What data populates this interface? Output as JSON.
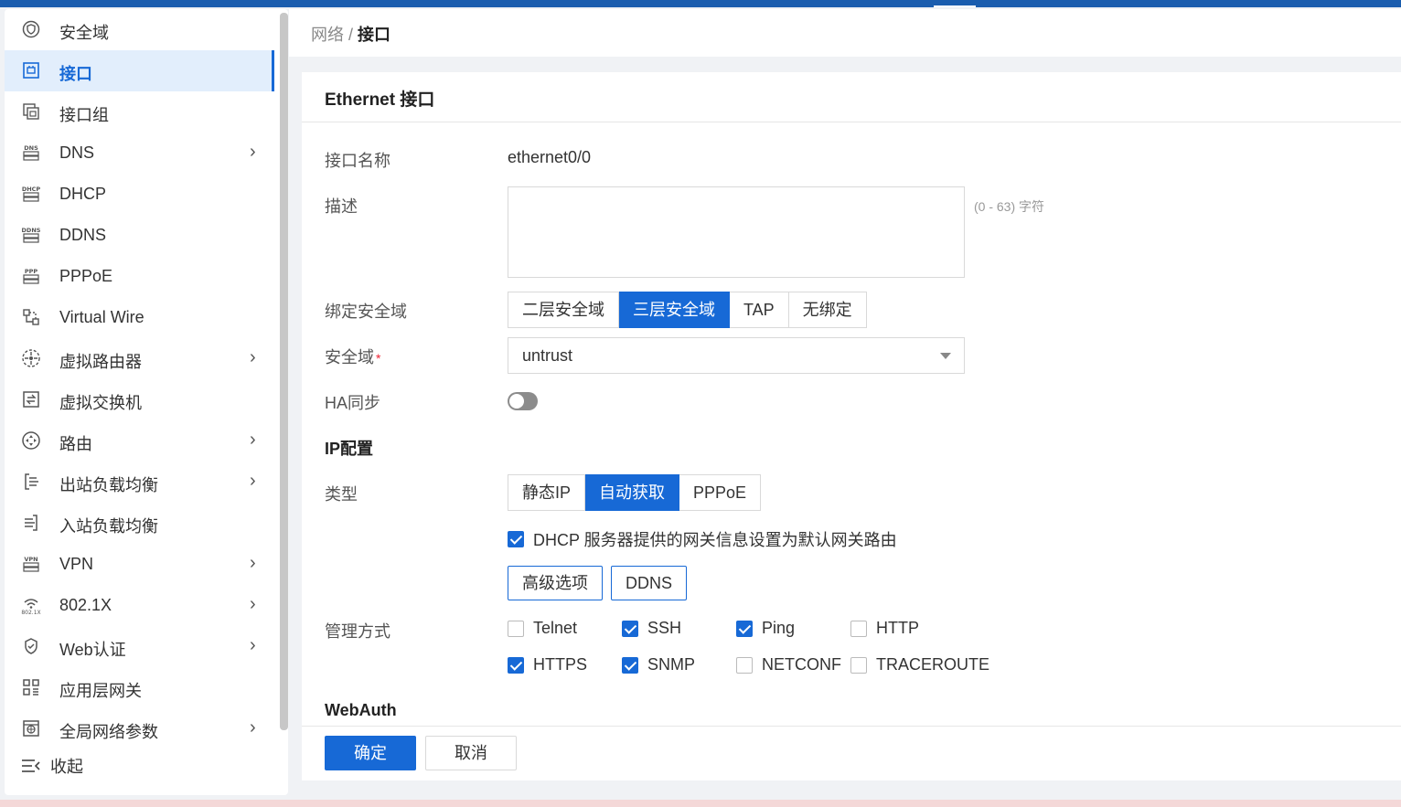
{
  "breadcrumb": {
    "parent": "网络",
    "separator": "/",
    "current": "接口"
  },
  "sidebar": {
    "items": [
      {
        "label": "安全域",
        "icon": "shield-icon",
        "chevron": false,
        "active": false
      },
      {
        "label": "接口",
        "icon": "interface-icon",
        "chevron": false,
        "active": true
      },
      {
        "label": "接口组",
        "icon": "interface-group-icon",
        "chevron": false,
        "active": false
      },
      {
        "label": "DNS",
        "icon": "dns-icon",
        "chevron": true,
        "active": false
      },
      {
        "label": "DHCP",
        "icon": "dhcp-icon",
        "chevron": false,
        "active": false
      },
      {
        "label": "DDNS",
        "icon": "ddns-icon",
        "chevron": false,
        "active": false
      },
      {
        "label": "PPPoE",
        "icon": "pppoe-icon",
        "chevron": false,
        "active": false
      },
      {
        "label": "Virtual Wire",
        "icon": "virtual-wire-icon",
        "chevron": false,
        "active": false
      },
      {
        "label": "虚拟路由器",
        "icon": "virtual-router-icon",
        "chevron": true,
        "active": false
      },
      {
        "label": "虚拟交换机",
        "icon": "virtual-switch-icon",
        "chevron": false,
        "active": false
      },
      {
        "label": "路由",
        "icon": "route-icon",
        "chevron": true,
        "active": false
      },
      {
        "label": "出站负载均衡",
        "icon": "outbound-lb-icon",
        "chevron": true,
        "active": false
      },
      {
        "label": "入站负载均衡",
        "icon": "inbound-lb-icon",
        "chevron": false,
        "active": false
      },
      {
        "label": "VPN",
        "icon": "vpn-icon",
        "chevron": true,
        "active": false
      },
      {
        "label": "802.1X",
        "icon": "wifi-8021x-icon",
        "chevron": true,
        "active": false
      },
      {
        "label": "Web认证",
        "icon": "web-auth-icon",
        "chevron": true,
        "active": false
      },
      {
        "label": "应用层网关",
        "icon": "app-gateway-icon",
        "chevron": false,
        "active": false
      },
      {
        "label": "全局网络参数",
        "icon": "global-params-icon",
        "chevron": true,
        "active": false
      }
    ],
    "collapse_label": "收起"
  },
  "form": {
    "title": "Ethernet 接口",
    "name_label": "接口名称",
    "name_value": "ethernet0/0",
    "desc_label": "描述",
    "desc_value": "",
    "desc_hint": "(0 - 63) 字符",
    "bind_label": "绑定安全域",
    "bind_options": [
      "二层安全域",
      "三层安全域",
      "TAP",
      "无绑定"
    ],
    "bind_selected": "三层安全域",
    "zone_label": "安全域",
    "zone_required_mark": "*",
    "zone_value": "untrust",
    "ha_label": "HA同步",
    "ha_on": false,
    "ip_section": "IP配置",
    "type_label": "类型",
    "type_options": [
      "静态IP",
      "自动获取",
      "PPPoE"
    ],
    "type_selected": "自动获取",
    "dhcp_gateway_label": "DHCP 服务器提供的网关信息设置为默认网关路由",
    "dhcp_gateway_checked": true,
    "advanced_button": "高级选项",
    "ddns_button": "DDNS",
    "mgmt_label": "管理方式",
    "mgmt_options": [
      {
        "label": "Telnet",
        "checked": false
      },
      {
        "label": "SSH",
        "checked": true
      },
      {
        "label": "Ping",
        "checked": true
      },
      {
        "label": "HTTP",
        "checked": false
      },
      {
        "label": "HTTPS",
        "checked": true
      },
      {
        "label": "SNMP",
        "checked": true
      },
      {
        "label": "NETCONF",
        "checked": false
      },
      {
        "label": "TRACEROUTE",
        "checked": false
      }
    ],
    "webauth_section": "WebAuth",
    "ok_button": "确定",
    "cancel_button": "取消"
  },
  "colors": {
    "accent": "#1769d6",
    "topbar": "#1a5dae"
  }
}
